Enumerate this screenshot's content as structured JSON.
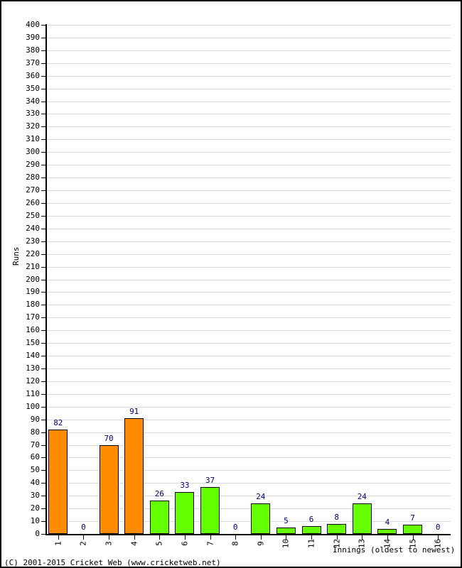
{
  "chart_data": {
    "type": "bar",
    "title": "",
    "xlabel": "Innings (oldest to newest)",
    "ylabel": "Runs",
    "categories": [
      "1",
      "2",
      "3",
      "4",
      "5",
      "6",
      "7",
      "8",
      "9",
      "10",
      "11",
      "12",
      "13",
      "14",
      "15",
      "16"
    ],
    "values": [
      82,
      0,
      70,
      91,
      26,
      33,
      37,
      0,
      24,
      5,
      6,
      8,
      24,
      4,
      7,
      0
    ],
    "bar_colors": [
      "#FF8C00",
      "#FF8C00",
      "#FF8C00",
      "#FF8C00",
      "#66FF00",
      "#66FF00",
      "#66FF00",
      "#66FF00",
      "#66FF00",
      "#66FF00",
      "#66FF00",
      "#66FF00",
      "#66FF00",
      "#66FF00",
      "#66FF00",
      "#66FF00"
    ],
    "ylim": [
      0,
      400
    ],
    "ytick_step": 10,
    "yticks": [
      0,
      10,
      20,
      30,
      40,
      50,
      60,
      70,
      80,
      90,
      100,
      110,
      120,
      130,
      140,
      150,
      160,
      170,
      180,
      190,
      200,
      210,
      220,
      230,
      240,
      250,
      260,
      270,
      280,
      290,
      300,
      310,
      320,
      330,
      340,
      350,
      360,
      370,
      380,
      390,
      400
    ],
    "grid": true,
    "legend": "none",
    "value_label_color": "#000080",
    "axis_color": "#000000",
    "gridline_color": "#D9D9D9",
    "background_color": "#FFFFFF"
  },
  "footer": {
    "text": "(C) 2001-2015 Cricket Web (www.cricketweb.net)"
  }
}
